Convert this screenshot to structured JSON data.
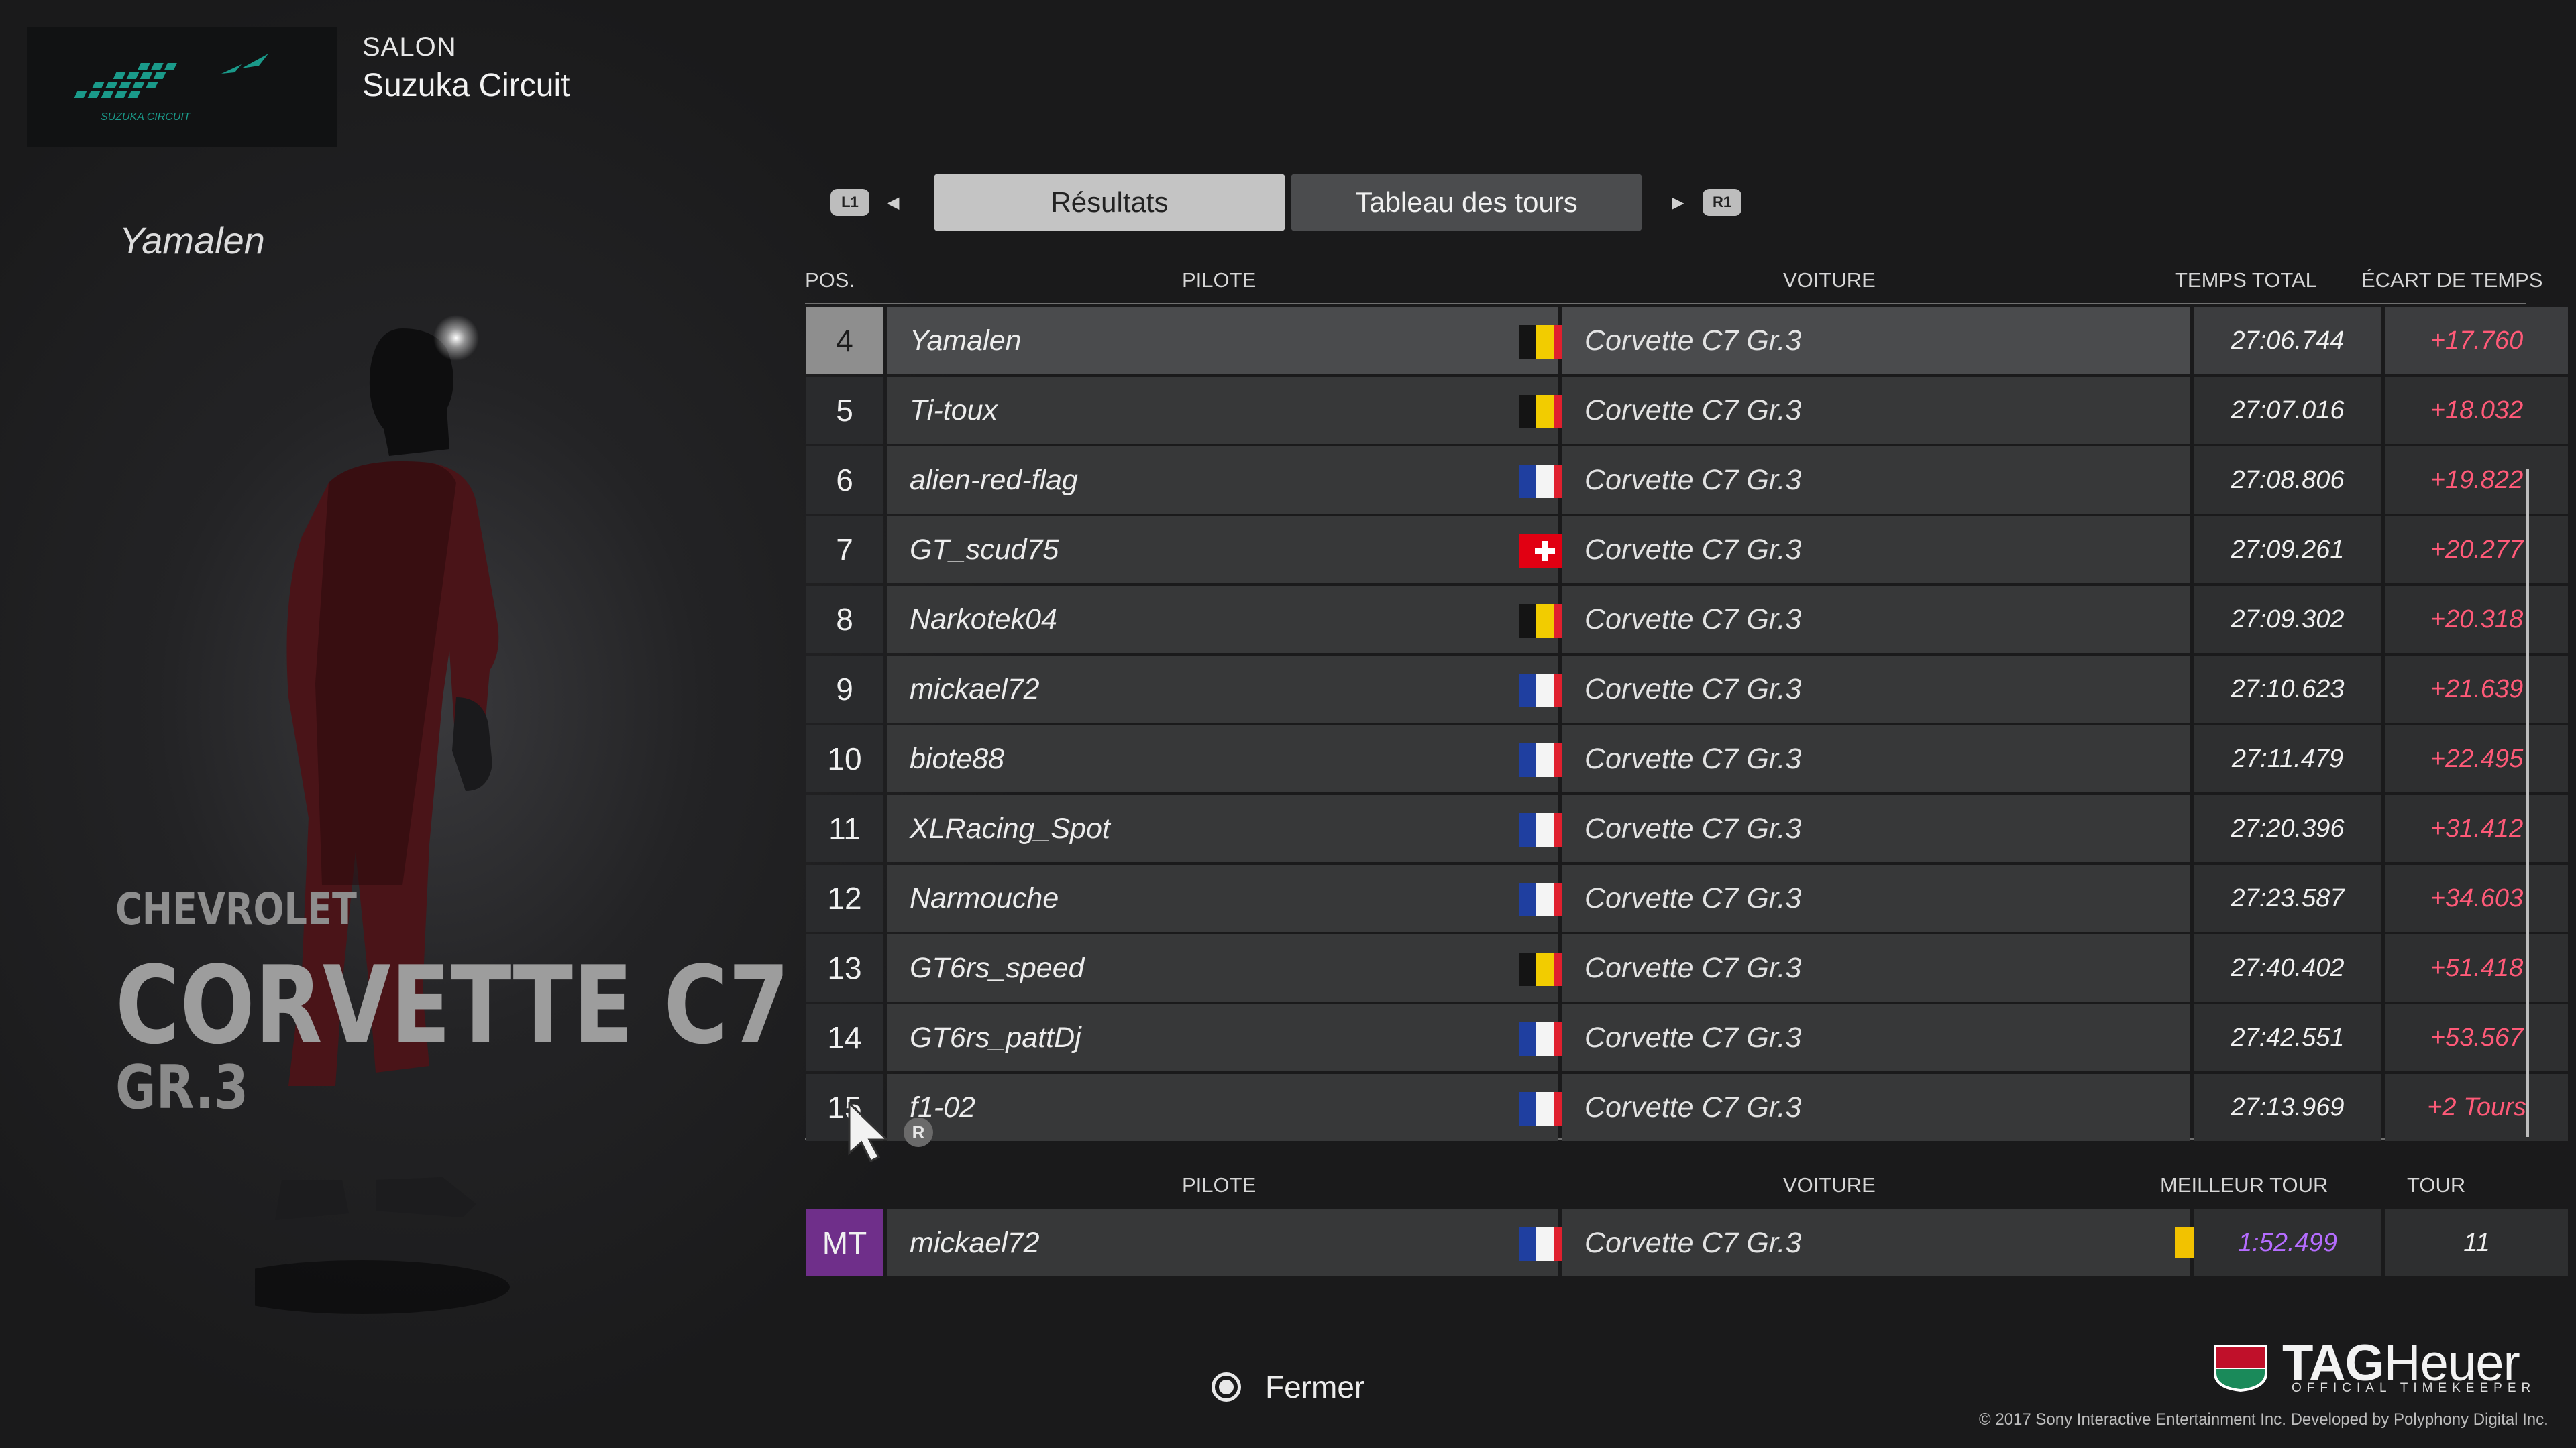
{
  "header": {
    "event_label": "SALON",
    "track_name": "Suzuka Circuit",
    "track_logo_text": "SUZUKA CIRCUIT"
  },
  "left_panel": {
    "driver_name": "Yamalen",
    "car_make": "CHEVROLET",
    "car_model": "CORVETTE C7",
    "car_class": "GR.3"
  },
  "tabs": {
    "left_hint": "L1",
    "right_hint": "R1",
    "items": [
      {
        "label": "Résultats",
        "selected": true
      },
      {
        "label": "Tableau des tours",
        "selected": false
      }
    ]
  },
  "results": {
    "headers": {
      "pos": "POS.",
      "driver": "PILOTE",
      "car": "VOITURE",
      "total_time": "TEMPS TOTAL",
      "gap": "ÉCART DE TEMPS"
    },
    "rows": [
      {
        "pos": "4",
        "driver": "Yamalen",
        "flag": "be",
        "car": "Corvette C7 Gr.3",
        "time": "27:06.744",
        "gap": "+17.760"
      },
      {
        "pos": "5",
        "driver": "Ti-toux",
        "flag": "be",
        "car": "Corvette C7 Gr.3",
        "time": "27:07.016",
        "gap": "+18.032"
      },
      {
        "pos": "6",
        "driver": "alien-red-flag",
        "flag": "fr",
        "car": "Corvette C7 Gr.3",
        "time": "27:08.806",
        "gap": "+19.822"
      },
      {
        "pos": "7",
        "driver": "GT_scud75",
        "flag": "ch",
        "car": "Corvette C7 Gr.3",
        "time": "27:09.261",
        "gap": "+20.277"
      },
      {
        "pos": "8",
        "driver": "Narkotek04",
        "flag": "be",
        "car": "Corvette C7 Gr.3",
        "time": "27:09.302",
        "gap": "+20.318"
      },
      {
        "pos": "9",
        "driver": "mickael72",
        "flag": "fr",
        "car": "Corvette C7 Gr.3",
        "time": "27:10.623",
        "gap": "+21.639"
      },
      {
        "pos": "10",
        "driver": "biote88",
        "flag": "fr",
        "car": "Corvette C7 Gr.3",
        "time": "27:11.479",
        "gap": "+22.495"
      },
      {
        "pos": "11",
        "driver": "XLRacing_Spot",
        "flag": "fr",
        "car": "Corvette C7 Gr.3",
        "time": "27:20.396",
        "gap": "+31.412"
      },
      {
        "pos": "12",
        "driver": "Narmouche",
        "flag": "fr",
        "car": "Corvette C7 Gr.3",
        "time": "27:23.587",
        "gap": "+34.603"
      },
      {
        "pos": "13",
        "driver": "GT6rs_speed",
        "flag": "be",
        "car": "Corvette C7 Gr.3",
        "time": "27:40.402",
        "gap": "+51.418"
      },
      {
        "pos": "14",
        "driver": "GT6rs_pattDj",
        "flag": "fr",
        "car": "Corvette C7 Gr.3",
        "time": "27:42.551",
        "gap": "+53.567"
      },
      {
        "pos": "15",
        "driver": "f1-02",
        "flag": "fr",
        "car": "Corvette C7 Gr.3",
        "time": "27:13.969",
        "gap": "+2 Tours"
      }
    ]
  },
  "fastest_lap": {
    "headers": {
      "driver": "PILOTE",
      "car": "VOITURE",
      "best_lap": "MEILLEUR TOUR",
      "lap": "TOUR"
    },
    "badge": "MT",
    "driver": "mickael72",
    "flag": "fr",
    "car": "Corvette C7 Gr.3",
    "best_lap": "1:52.499",
    "lap": "11",
    "marker_color": "#f2c200"
  },
  "cursor_badge": "R",
  "footer": {
    "close_label": "Fermer",
    "brand_bold": "TAG",
    "brand_light": "Heuer",
    "brand_sub": "OFFICIAL TIMEKEEPER",
    "copyright": "© 2017 Sony Interactive Entertainment Inc. Developed by Polyphony Digital Inc."
  },
  "colors": {
    "accent_gap": "#ff5a78",
    "best_lap": "#b56cff",
    "mt_badge": "#6f2f8a"
  }
}
